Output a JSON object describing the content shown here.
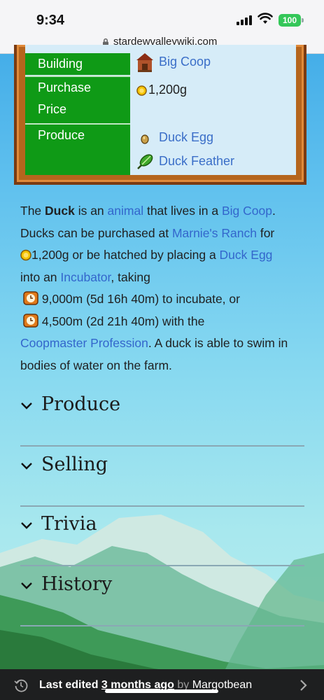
{
  "status_bar": {
    "time": "9:34",
    "battery": "100"
  },
  "browser": {
    "url": "stardewvalleywiki.com"
  },
  "infobox": {
    "rows": [
      {
        "label": "Building",
        "values": [
          {
            "text": "Big Coop",
            "link": true,
            "icon": "coop-icon"
          }
        ]
      },
      {
        "label": "Purchase Price",
        "label_line1": "Purchase",
        "label_line2": "Price",
        "values": [
          {
            "text": "1,200g",
            "link": false,
            "icon": "gold-coin-icon"
          }
        ]
      },
      {
        "label": "Produce",
        "values": [
          {
            "text": "Duck Egg",
            "link": true,
            "icon": "duck-egg-icon"
          },
          {
            "text": "Duck Feather",
            "link": true,
            "icon": "duck-feather-icon"
          }
        ]
      }
    ]
  },
  "article": {
    "p1": "The ",
    "duck": "Duck",
    "p2": " is an ",
    "animal": "animal",
    "p3": " that lives in a ",
    "big_coop": "Big Coop",
    "p4": ". Ducks can be purchased at ",
    "marnies": "Marnie's Ranch",
    "p5": " for ",
    "price": "1,200g",
    "p6": " or be hatched by placing a ",
    "duck_egg": "Duck Egg",
    "p7": " into an ",
    "incubator": "Incubator",
    "p8": ", taking",
    "time1": "9,000m (5d 16h 40m) to incubate, or",
    "time2": "4,500m (2d 21h 40m) with the",
    "coopmaster": "Coopmaster Profession",
    "p9": ". A duck is able to swim in bodies of water on the farm."
  },
  "sections": [
    "Produce",
    "Selling",
    "Trivia",
    "History"
  ],
  "footer": {
    "last_edited": "Last edited ",
    "when": "3 months ago",
    "by": " by ",
    "user": "Margotbean"
  },
  "colors": {
    "link": "#3366cc",
    "infobox_label_bg": "#0f9a16",
    "frame": "#b5651d"
  }
}
